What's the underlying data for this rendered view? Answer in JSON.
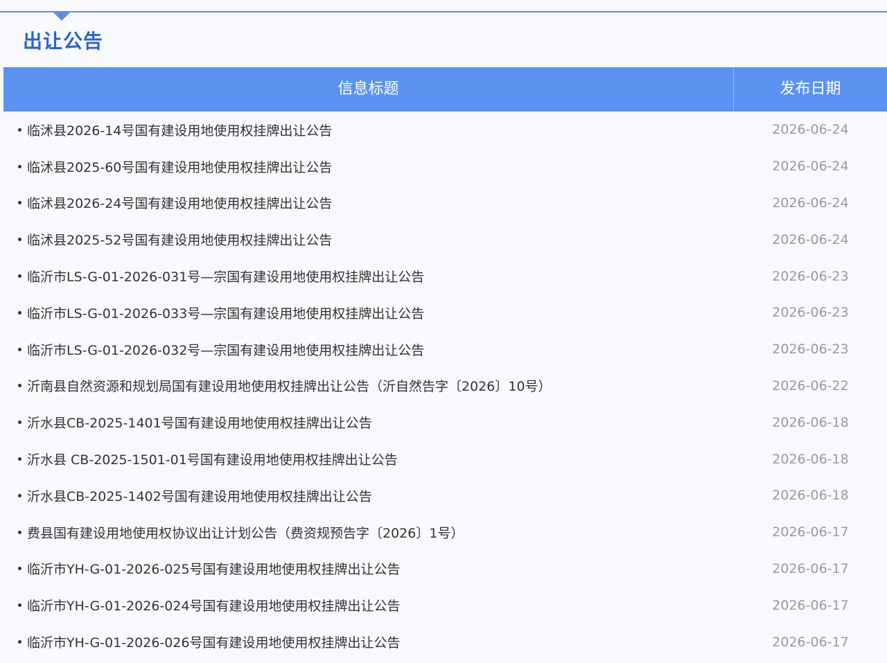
{
  "section": {
    "title": "出让公告"
  },
  "table": {
    "headers": {
      "title": "信息标题",
      "date": "发布日期"
    },
    "rows": [
      {
        "title": "临沭县2026-14号国有建设用地使用权挂牌出让公告",
        "date": "2026-06-24"
      },
      {
        "title": "临沭县2025-60号国有建设用地使用权挂牌出让公告",
        "date": "2026-06-24"
      },
      {
        "title": "临沭县2026-24号国有建设用地使用权挂牌出让公告",
        "date": "2026-06-24"
      },
      {
        "title": "临沭县2025-52号国有建设用地使用权挂牌出让公告",
        "date": "2026-06-24"
      },
      {
        "title": "临沂市LS-G-01-2026-031号—宗国有建设用地使用权挂牌出让公告",
        "date": "2026-06-23"
      },
      {
        "title": "临沂市LS-G-01-2026-033号—宗国有建设用地使用权挂牌出让公告",
        "date": "2026-06-23"
      },
      {
        "title": "临沂市LS-G-01-2026-032号—宗国有建设用地使用权挂牌出让公告",
        "date": "2026-06-23"
      },
      {
        "title": "沂南县自然资源和规划局国有建设用地使用权挂牌出让公告（沂自然告字〔2026〕10号）",
        "date": "2026-06-22"
      },
      {
        "title": "沂水县CB-2025-1401号国有建设用地使用权挂牌出让公告",
        "date": "2026-06-18"
      },
      {
        "title": "沂水县 CB-2025-1501-01号国有建设用地使用权挂牌出让公告",
        "date": "2026-06-18"
      },
      {
        "title": "沂水县CB-2025-1402号国有建设用地使用权挂牌出让公告",
        "date": "2026-06-18"
      },
      {
        "title": "费县国有建设用地使用权协议出让计划公告（费资规预告字〔2026〕1号）",
        "date": "2026-06-17"
      },
      {
        "title": "临沂市YH-G-01-2026-025号国有建设用地使用权挂牌出让公告",
        "date": "2026-06-17"
      },
      {
        "title": "临沂市YH-G-01-2026-024号国有建设用地使用权挂牌出让公告",
        "date": "2026-06-17"
      },
      {
        "title": "临沂市YH-G-01-2026-026号国有建设用地使用权挂牌出让公告",
        "date": "2026-06-17"
      }
    ]
  },
  "colors": {
    "accent": "#5b93f0",
    "title_blue": "#2d64c8",
    "text": "#333333",
    "date_gray": "#9a9a9a"
  }
}
